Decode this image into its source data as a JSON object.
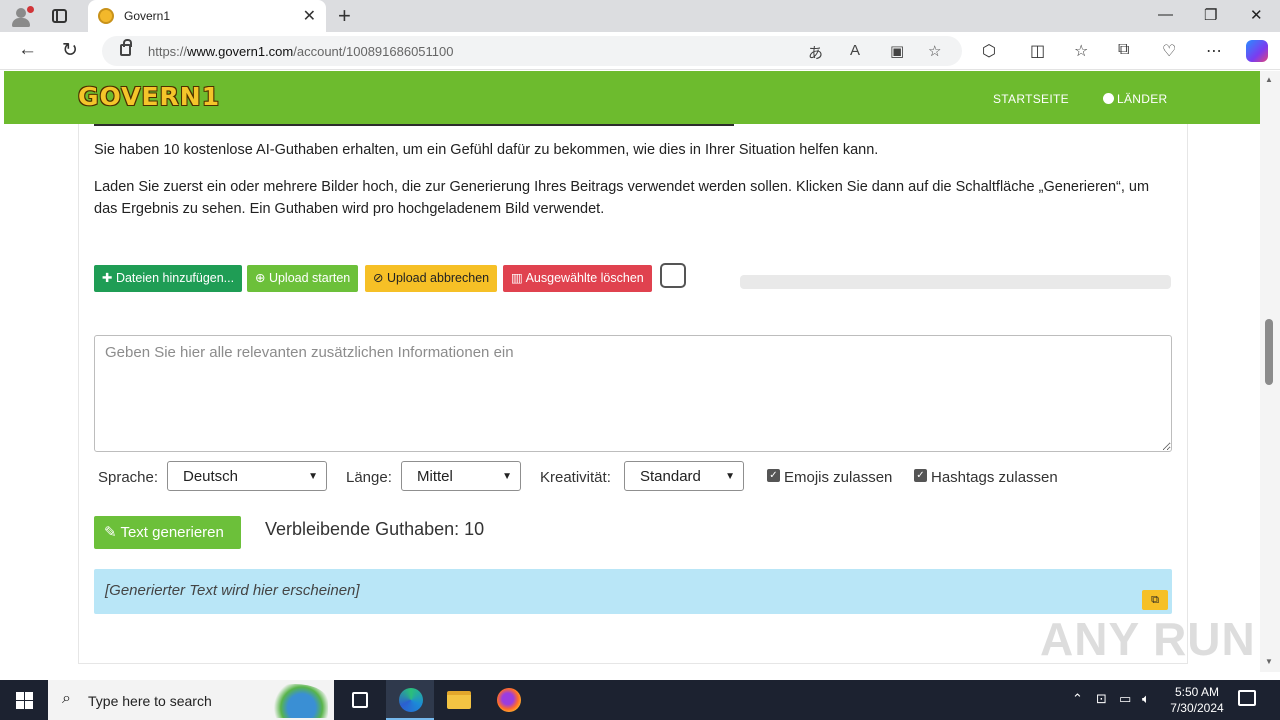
{
  "browser": {
    "tab_title": "Govern1",
    "url_prefix": "https://",
    "url_host": "www.govern1.com",
    "url_path": "/account/100891686051100"
  },
  "site": {
    "logo_text": "GOVERN1",
    "nav": {
      "home": "STARTSEITE",
      "countries": "LÄNDER"
    }
  },
  "content": {
    "intro": "Sie haben 10 kostenlose AI-Guthaben erhalten, um ein Gefühl dafür zu bekommen, wie dies in Ihrer Situation helfen kann.",
    "instructions": "Laden Sie zuerst ein oder mehrere Bilder hoch, die zur Generierung Ihres Beitrags verwendet werden sollen. Klicken Sie dann auf die Schaltfläche „Generieren“, um das Ergebnis zu sehen. Ein Guthaben wird pro hochgeladenem Bild verwendet.",
    "buttons": {
      "add_files": "Dateien hinzufügen...",
      "start_upload": "Upload starten",
      "cancel_upload": "Upload abbrechen",
      "delete_selected": "Ausgewählte löschen"
    },
    "upload_progress": 0,
    "info_placeholder": "Geben Sie hier alle relevanten zusätzlichen Informationen ein",
    "options": {
      "language_label": "Sprache:",
      "language_value": "Deutsch",
      "length_label": "Länge:",
      "length_value": "Mittel",
      "creativity_label": "Kreativität:",
      "creativity_value": "Standard",
      "emojis_label": "Emojis zulassen",
      "emojis_checked": true,
      "hashtags_label": "Hashtags zulassen",
      "hashtags_checked": true
    },
    "generate_button": "Text generieren",
    "remaining_credits": "Verbleibende Guthaben: 10",
    "result_placeholder": "[Generierter Text wird hier erscheinen]"
  },
  "watermark": "ANY RUN",
  "taskbar": {
    "search_placeholder": "Type here to search",
    "time": "5:50 AM",
    "date": "7/30/2024"
  },
  "colors": {
    "brand_green": "#6dbb2e",
    "btn_add": "#1f9d55",
    "btn_start": "#6cc03a",
    "btn_cancel": "#f6c026",
    "btn_delete": "#e0424f",
    "result_bg": "#b9e6f7"
  }
}
